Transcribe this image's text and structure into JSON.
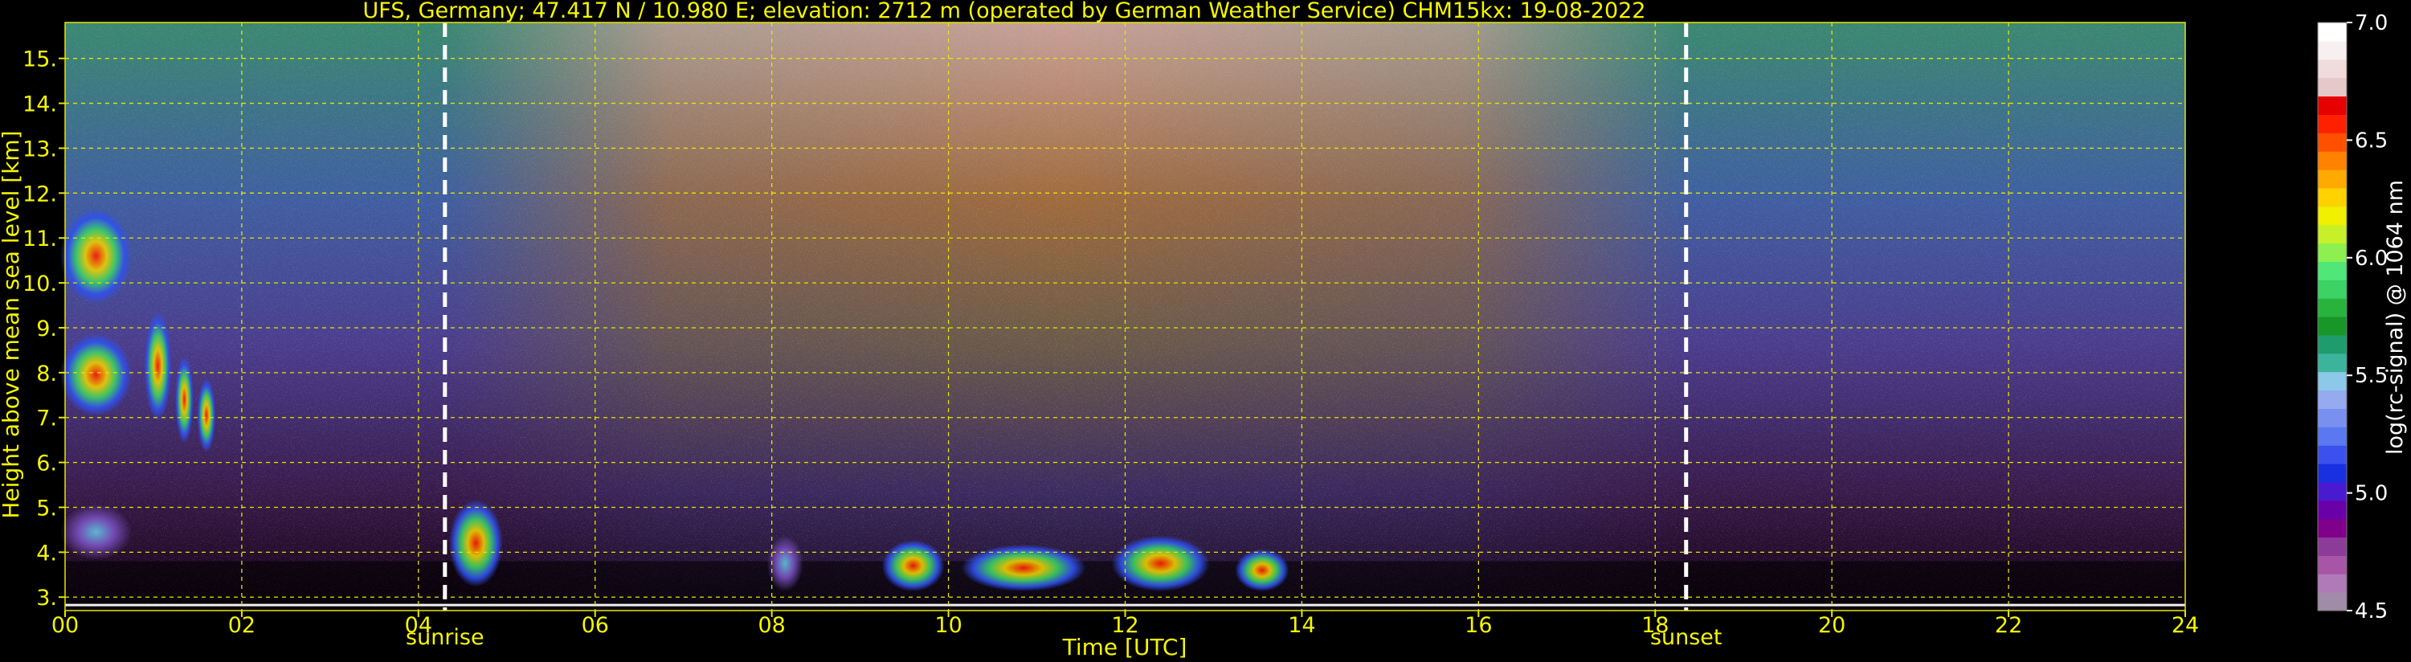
{
  "chart_data": {
    "type": "heatmap",
    "title": "UFS, Germany; 47.417 N / 10.980 E; elevation: 2712 m  (operated by German Weather Service)    CHM15kx: 19-08-2022",
    "xlabel": "Time [UTC]",
    "ylabel": "Height above mean sea level [km]",
    "xlim": [
      0,
      24
    ],
    "ylim": [
      2.7,
      15.8
    ],
    "x_ticks": [
      0,
      2,
      4,
      6,
      8,
      10,
      12,
      14,
      16,
      18,
      20,
      22,
      24
    ],
    "x_tick_labels": [
      "00",
      "02",
      "04",
      "06",
      "08",
      "10",
      "12",
      "14",
      "16",
      "18",
      "20",
      "22",
      "24"
    ],
    "y_ticks": [
      3,
      4,
      5,
      6,
      7,
      8,
      9,
      10,
      11,
      12,
      13,
      14,
      15
    ],
    "y_tick_labels": [
      "3.",
      "4.",
      "5.",
      "6.",
      "7.",
      "8.",
      "9.",
      "10.",
      "11.",
      "12.",
      "13.",
      "14.",
      "15."
    ],
    "grid": true,
    "annotations": [
      {
        "label": "sunrise",
        "x": 4.3
      },
      {
        "label": "sunset",
        "x": 18.35
      }
    ],
    "colorbar": {
      "label": "log(rc-signal) @ 1064 nm",
      "range": [
        4.5,
        7.0
      ],
      "ticks": [
        4.5,
        5.0,
        5.5,
        6.0,
        6.5,
        7.0
      ],
      "tick_labels": [
        "4.5",
        "5.0",
        "5.5",
        "6.0",
        "6.5",
        "7.0"
      ],
      "colors": [
        "#a08ca8",
        "#b07ab8",
        "#a855a8",
        "#8c3c98",
        "#80008c",
        "#6a00a8",
        "#4a1ad0",
        "#1830e0",
        "#3c50f0",
        "#5a78f0",
        "#7890f0",
        "#96aaf0",
        "#8cc8e8",
        "#3cb49c",
        "#1e9c6e",
        "#189628",
        "#28b43c",
        "#3cd264",
        "#50e678",
        "#8cf050",
        "#c8f028",
        "#f0f000",
        "#ffd200",
        "#ffaa00",
        "#ff8200",
        "#ff5000",
        "#ff2000",
        "#e60000",
        "#e6c8c8",
        "#f0dcdc",
        "#f8f0f0",
        "#ffffff"
      ]
    },
    "cloud_features": [
      {
        "x": [
          0.0,
          0.7
        ],
        "y": [
          9.6,
          11.6
        ],
        "value": 6.5
      },
      {
        "x": [
          0.0,
          0.7
        ],
        "y": [
          7.1,
          8.8
        ],
        "value": 6.4
      },
      {
        "x": [
          0.95,
          1.15
        ],
        "y": [
          7.0,
          9.3
        ],
        "value": 6.4
      },
      {
        "x": [
          1.3,
          1.4
        ],
        "y": [
          6.5,
          8.3
        ],
        "value": 6.3
      },
      {
        "x": [
          1.55,
          1.65
        ],
        "y": [
          6.3,
          7.8
        ],
        "value": 6.0
      },
      {
        "x": [
          0.0,
          0.7
        ],
        "y": [
          3.9,
          5.0
        ],
        "value": 5.2
      },
      {
        "x": [
          4.4,
          4.9
        ],
        "y": [
          3.3,
          5.1
        ],
        "value": 6.4
      },
      {
        "x": [
          8.0,
          8.3
        ],
        "y": [
          3.2,
          4.3
        ],
        "value": 5.7
      },
      {
        "x": [
          9.3,
          9.9
        ],
        "y": [
          3.2,
          4.2
        ],
        "value": 6.6
      },
      {
        "x": [
          10.2,
          11.5
        ],
        "y": [
          3.2,
          4.1
        ],
        "value": 6.5
      },
      {
        "x": [
          11.9,
          12.9
        ],
        "y": [
          3.2,
          4.3
        ],
        "value": 6.6
      },
      {
        "x": [
          13.3,
          13.8
        ],
        "y": [
          3.2,
          4.0
        ],
        "value": 6.3
      }
    ]
  }
}
